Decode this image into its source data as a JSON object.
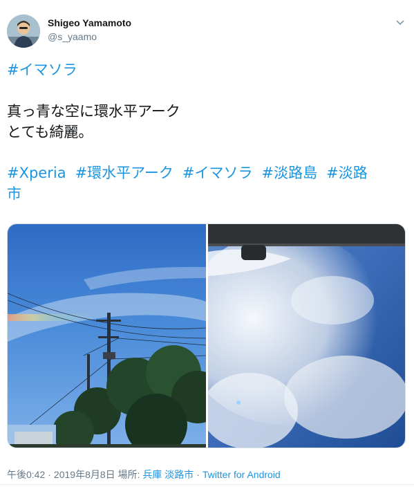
{
  "author": {
    "name": "Shigeo Yamamoto",
    "handle": "@s_yaamo"
  },
  "tweet": {
    "hashtag_top": "#イマソラ",
    "line1": "真っ青な空に環水平アーク",
    "line2": "とても綺麗。",
    "hashtags": [
      "#Xperia",
      "#環水平アーク",
      "#イマソラ",
      "#淡路島",
      "#淡路"
    ],
    "hashtag_wrap": "市"
  },
  "footer": {
    "time": "午後0:42",
    "date": "2019年8月8日",
    "place_label": "場所:",
    "place": "兵庫 淡路市",
    "client": "Twitter for Android",
    "separator": "·"
  },
  "icons": {
    "menu": "chevron-down-icon",
    "avatar": "avatar"
  },
  "colors": {
    "link": "#1b95e0",
    "muted": "#657786",
    "text": "#14171a"
  }
}
